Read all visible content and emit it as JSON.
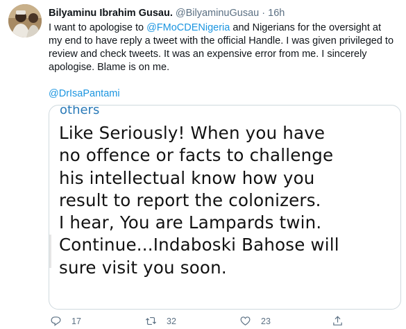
{
  "tweet": {
    "author_name": "Bilyaminu Ibrahim Gusau.",
    "handle": "@BilyaminuGusau",
    "separator": "·",
    "time": "16h",
    "text_before": "I want to apologise to ",
    "text_mention": "@FMoCDENigeria",
    "text_after": " and Nigerians for the oversight at my end to have reply a tweet with the official Handle. I was given privileged to review and check tweets. It was an expensive error from me. I sincerely apologise. Blame is on me.",
    "mention": "@DrIsaPantami"
  },
  "media": {
    "top_fragment": "others",
    "lines": [
      "Like Seriously! When you have",
      "no offence or facts to challenge",
      "his intellectual know how you",
      "result to report the colonizers.",
      "I hear, You are Lampards twin.",
      "Continue...Indaboski Bahose will",
      "sure visit you soon."
    ]
  },
  "actions": {
    "reply_count": "17",
    "retweet_count": "32",
    "like_count": "23",
    "icons": [
      "reply-icon",
      "retweet-icon",
      "like-icon",
      "share-icon"
    ]
  },
  "colors": {
    "link": "#1b95e0",
    "muted": "#5b7083",
    "text": "#0f1419"
  }
}
